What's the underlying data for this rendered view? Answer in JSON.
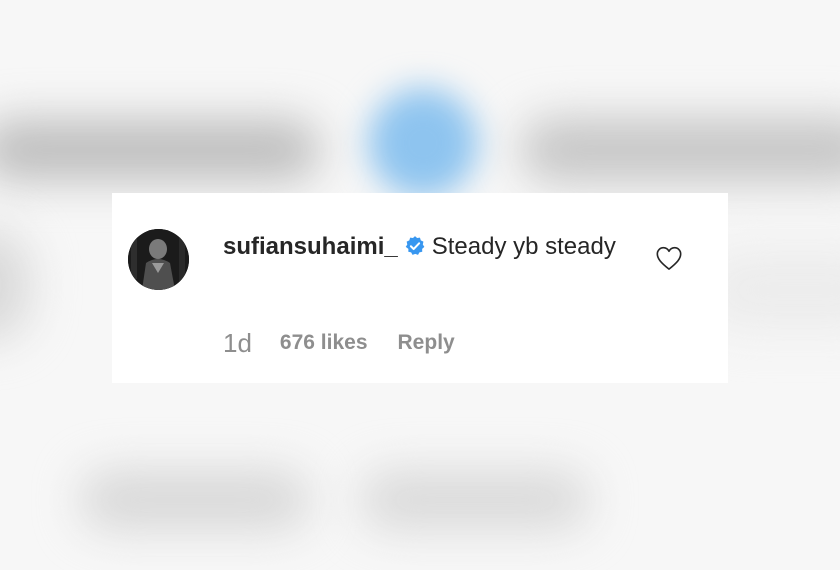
{
  "comment": {
    "username": "sufiansuhaimi_",
    "verified": true,
    "text": "Steady yb steady",
    "time": "1d",
    "likes": "676 likes",
    "reply_label": "Reply"
  },
  "icons": {
    "verified": "verified-badge-icon",
    "like": "heart-outline-icon",
    "avatar": "profile-avatar"
  },
  "colors": {
    "verified_blue": "#3897f0",
    "text": "#262626",
    "meta": "#8e8e8e"
  }
}
